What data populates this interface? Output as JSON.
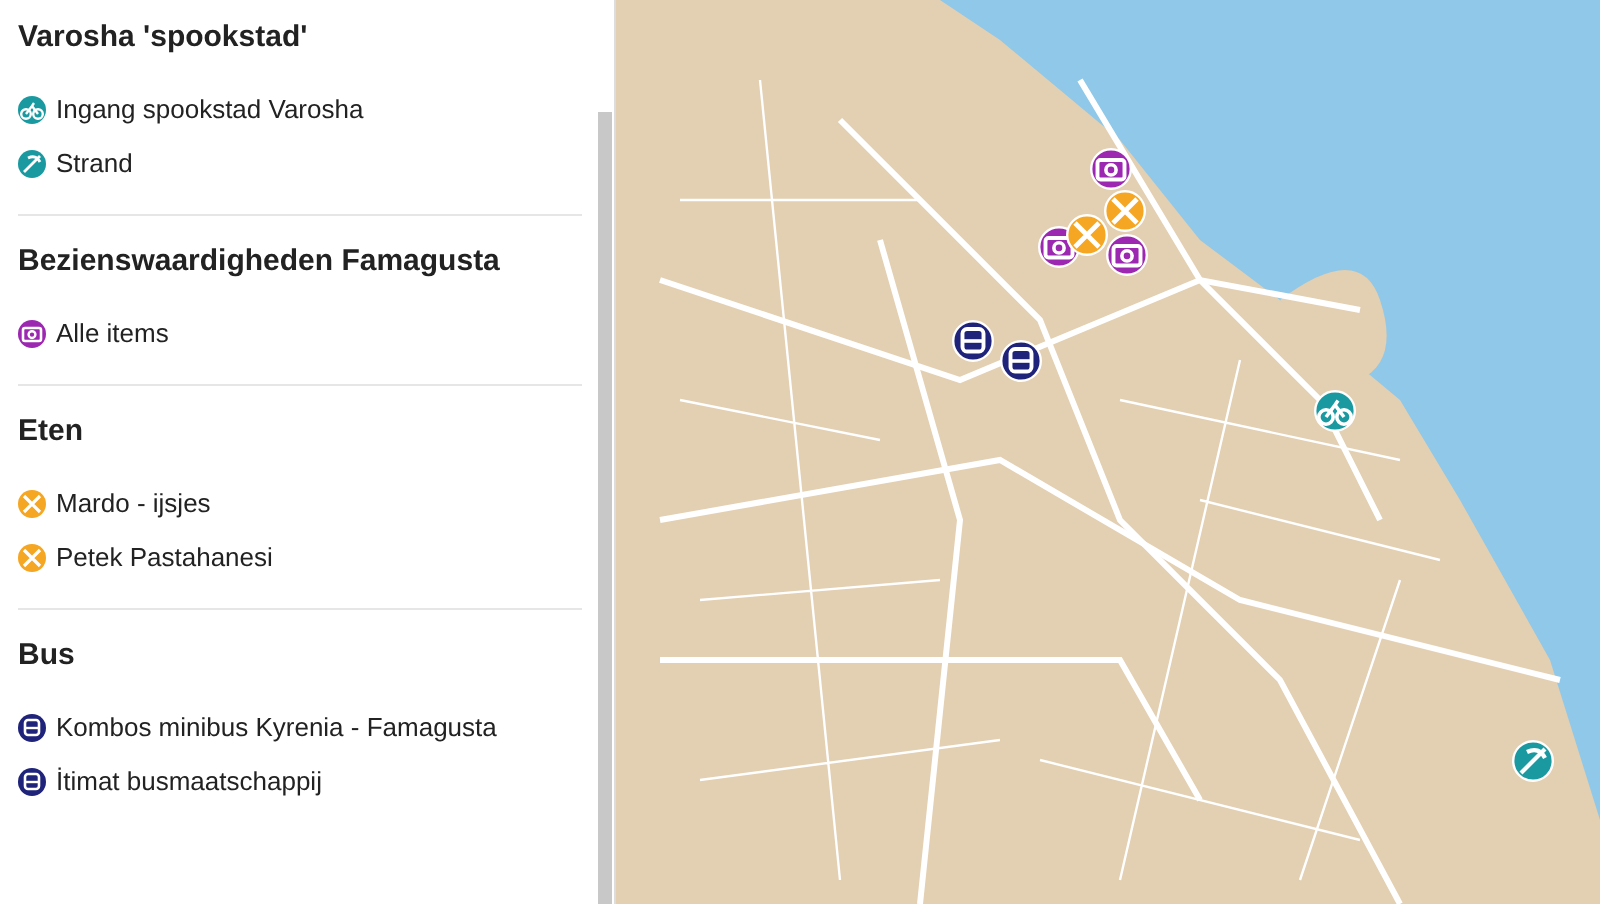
{
  "sidebar": {
    "sections": [
      {
        "title": "Varosha 'spookstad'",
        "items": [
          {
            "label": "Ingang spookstad Varosha",
            "kind": "bike"
          },
          {
            "label": "Strand",
            "kind": "beach"
          }
        ]
      },
      {
        "title": "Bezienswaardigheden Famagusta",
        "items": [
          {
            "label": "Alle items",
            "kind": "camera"
          }
        ]
      },
      {
        "title": "Eten",
        "items": [
          {
            "label": "Mardo - ijsjes",
            "kind": "food"
          },
          {
            "label": "Petek Pastahanesi",
            "kind": "food"
          }
        ]
      },
      {
        "title": "Bus",
        "items": [
          {
            "label": "Kombos minibus Kyrenia - Famagusta",
            "kind": "bus"
          },
          {
            "label": "İtimat busmaatschappij",
            "kind": "bus"
          }
        ]
      }
    ]
  },
  "map": {
    "markers": [
      {
        "kind": "camera"
      },
      {
        "kind": "food"
      },
      {
        "kind": "camera"
      },
      {
        "kind": "food"
      },
      {
        "kind": "camera"
      },
      {
        "kind": "bus"
      },
      {
        "kind": "bus"
      },
      {
        "kind": "bike"
      },
      {
        "kind": "beach"
      }
    ]
  }
}
